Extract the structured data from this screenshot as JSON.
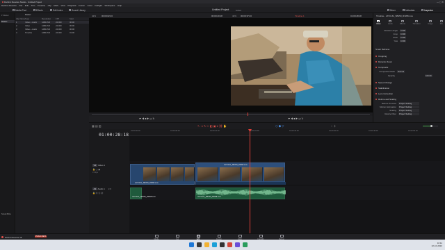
{
  "window": {
    "title": "DaVinci Resolve Studio - Untitled Project"
  },
  "menu": [
    "DaVinci Resolve",
    "File",
    "Edit",
    "Trim",
    "Timeline",
    "Clip",
    "Mark",
    "View",
    "Playback",
    "Fusion",
    "Color",
    "Fairlight",
    "Workspace",
    "Help"
  ],
  "toolbar": {
    "media_pool": "Media Pool",
    "effects": "Effects",
    "edit_index": "Edit Index",
    "sound_library": "Sound Library",
    "project_title": "Untitled Project",
    "edited": "Edited",
    "mixer": "Mixer",
    "metadata": "Metadata",
    "inspector": "Inspector"
  },
  "media_pool": {
    "bin_label": "Master",
    "smart_bins": "Smart Bins",
    "columns": [
      "Clip Name",
      "Type",
      "Resolution",
      "FPS",
      "Start"
    ],
    "rows": [
      [
        "1",
        "Video + Audio",
        "1280x720",
        "24.000",
        "00:00"
      ],
      [
        "2",
        "Video",
        "1280x720",
        "24.000",
        "00:00"
      ],
      [
        "3",
        "Video + Audio",
        "1280x720",
        "24.000",
        "00:00"
      ],
      [
        "4",
        "Timeline",
        "1280x720",
        "24.000",
        "01:00"
      ]
    ]
  },
  "viewer": {
    "zoom": "42%",
    "source_tc": "00:00:20:18",
    "src_dur": "00:00:02:23",
    "zoom2": "42%",
    "timeline_tc": "00:00:37:23",
    "timeline_name": "Timeline 1",
    "record_tc": "01:00:28:18"
  },
  "inspector": {
    "header": "Timeline - JAYCUG_SB150_R3W8.mov",
    "tabs": [
      "Video",
      "Audio",
      "Effects",
      "Transition",
      "Image",
      "File"
    ],
    "transform": [
      {
        "label": "Rotation Angle",
        "value": "0.000"
      },
      {
        "label": "Crop",
        "value": "0.000"
      },
      {
        "label": "Pitch",
        "value": "0.000"
      },
      {
        "label": "Yaw",
        "value": "0.000"
      }
    ],
    "smart_reframe": "Smart Reframe",
    "sections": [
      "Cropping",
      "Dynamic Zoom",
      "Composite",
      "Speed Change",
      "Stabilization",
      "Lens Correction",
      "Retime and Scaling"
    ],
    "composite_mode_label": "Composite Mode",
    "composite_mode": "Normal",
    "opacity_label": "Opacity",
    "opacity": "100.00",
    "retime": [
      {
        "label": "Retime Process",
        "value": "Project Setting"
      },
      {
        "label": "Motion Estimation",
        "value": "Project Setting"
      },
      {
        "label": "Scaling",
        "value": "Project Setting"
      },
      {
        "label": "Resize Filter",
        "value": "Project Setting"
      }
    ]
  },
  "timeline": {
    "timecode": "01:00:28:18",
    "ruler": [
      "01:00:00:00",
      "01:00:08:00",
      "01:00:16:00",
      "01:00:24:00",
      "01:00:32:00",
      "01:00:40:00",
      "01:00:48:00",
      "01:00:56:00"
    ],
    "tracks": {
      "v1": {
        "name": "Video 1",
        "id": "V1",
        "count": "3 Clips"
      },
      "a1": {
        "name": "Audio 1",
        "id": "A1",
        "level": "2.0"
      }
    },
    "clips": {
      "v_clip1": "JAYCUG_SB150_R3W8.mov",
      "v_clip2_speed": "Speed Change",
      "v_clip2": "JAYCUG_SB150_R3W8.mov",
      "a_clip1": "JAYCUG_SB150_R3W8.mov",
      "a_clip2": "JAYCUG_SB150_R3W8.mov"
    }
  },
  "pages": [
    "Media",
    "Cut",
    "Edit",
    "Fusion",
    "Color",
    "Fairlight",
    "Deliver"
  ],
  "active_page": "Edit",
  "footer": {
    "app": "DaVinci Resolve 18",
    "badge": "PUBLIC BETA"
  },
  "taskbar": {
    "time": "10:11",
    "date": "22-10-2022"
  },
  "colors": {
    "playhead": "#e0403a",
    "video_clip": "#27466e",
    "audio_clip": "#1f5a3c",
    "accent": "#e0504a"
  }
}
